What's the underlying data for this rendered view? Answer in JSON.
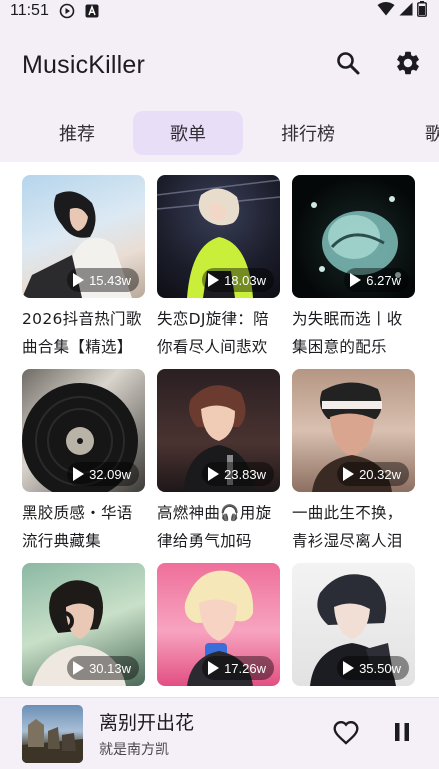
{
  "status_bar": {
    "time": "11:51",
    "icons": [
      "media-play-icon",
      "a-notification-icon",
      "wifi-icon",
      "signal-icon",
      "battery-icon"
    ]
  },
  "app_bar": {
    "title": "MusicKiller",
    "icons": [
      "search-icon",
      "gear-icon"
    ]
  },
  "tabs": [
    {
      "label": "推荐"
    },
    {
      "label": "歌单"
    },
    {
      "label": "排行榜"
    },
    {
      "label": "歌手"
    }
  ],
  "active_tab": "歌单",
  "playlists": [
    {
      "title": "2026抖音热门歌曲合集【精选】",
      "plays": "15.43w"
    },
    {
      "title": "失恋DJ旋律：陪你看尽人间悲欢",
      "plays": "18.03w"
    },
    {
      "title": "为失眠而选丨收集困意的配乐",
      "plays": "6.27w"
    },
    {
      "title": "黑胶质感・华语流行典藏集",
      "plays": "32.09w"
    },
    {
      "title": "高燃神曲🎧用旋律给勇气加码",
      "plays": "23.83w"
    },
    {
      "title": "一曲此生不换，青衫湿尽离人泪",
      "plays": "20.32w"
    },
    {
      "title": "",
      "plays": "30.13w"
    },
    {
      "title": "",
      "plays": "17.26w"
    },
    {
      "title": "",
      "plays": "35.50w"
    }
  ],
  "now_playing": {
    "title": "离别开出花",
    "artist": "就是南方凯",
    "icons": [
      "heart-icon",
      "pause-icon"
    ]
  },
  "colors": {
    "background": "#f4eef6",
    "active_tab": "#e8def8",
    "content": "#ffffff"
  }
}
